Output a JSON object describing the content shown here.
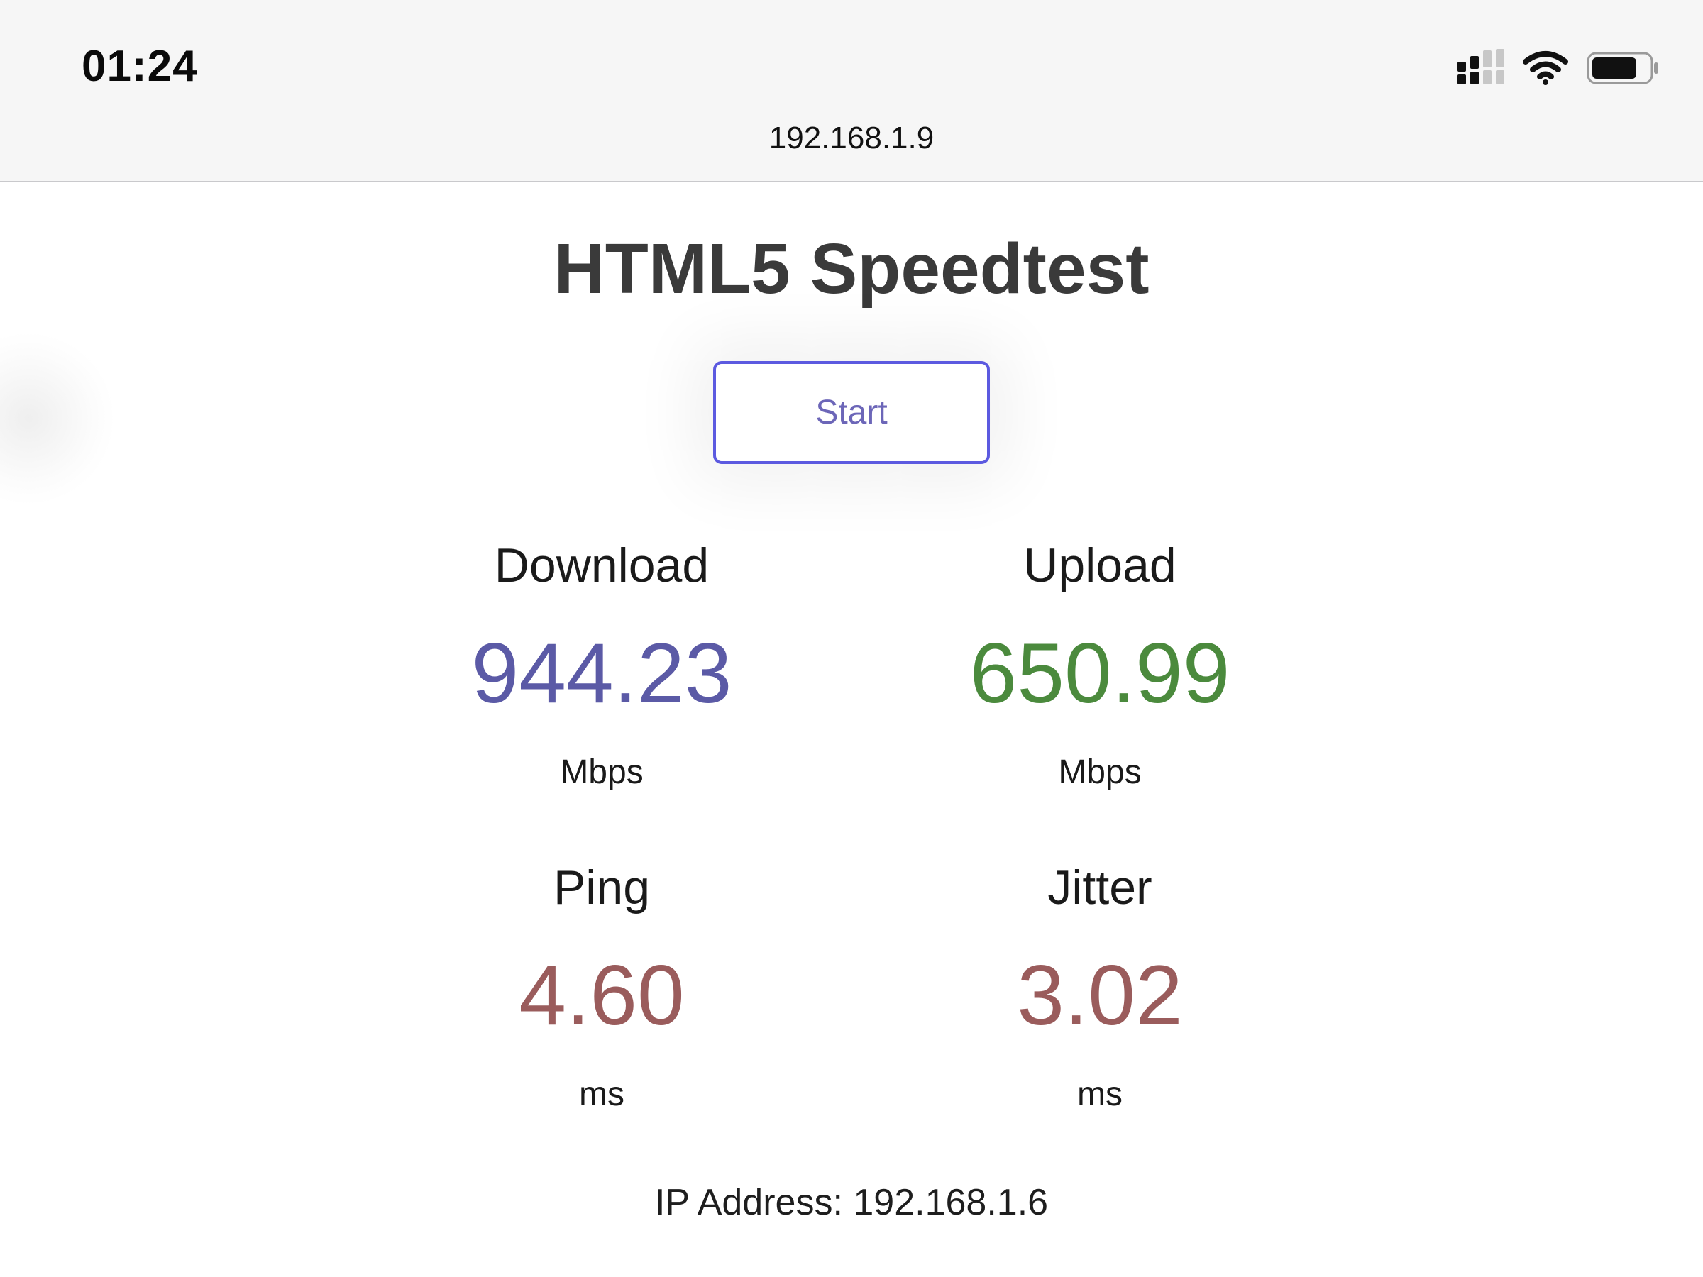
{
  "status_bar": {
    "time": "01:24",
    "icons": [
      "signal-icon",
      "wifi-icon",
      "battery-icon"
    ]
  },
  "browser": {
    "address": "192.168.1.9"
  },
  "page": {
    "title": "HTML5 Speedtest",
    "start_label": "Start",
    "metrics": [
      {
        "label": "Download",
        "value": "944.23",
        "unit": "Mbps",
        "color": "#5b5aa6"
      },
      {
        "label": "Upload",
        "value": "650.99",
        "unit": "Mbps",
        "color": "#4b8a3d"
      },
      {
        "label": "Ping",
        "value": "4.60",
        "unit": "ms",
        "color": "#9a5c5c"
      },
      {
        "label": "Jitter",
        "value": "3.02",
        "unit": "ms",
        "color": "#9a5c5c"
      }
    ],
    "ip_address": "IP Address: 192.168.1.6"
  },
  "colors": {
    "accent_border": "#5c5ae0",
    "start_text": "#6c66b8"
  }
}
